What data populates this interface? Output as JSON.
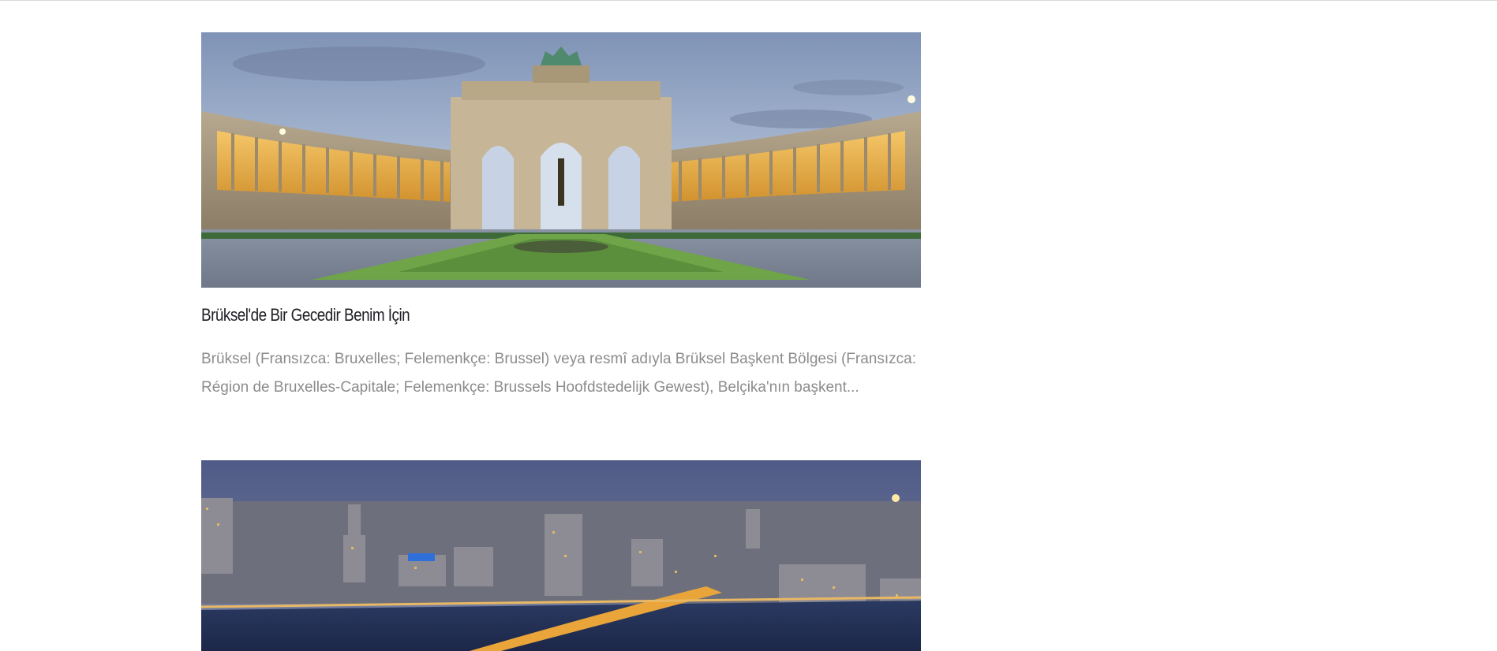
{
  "posts": [
    {
      "image_alt": "Cinquantenaire triumphal arch, Brussels, at dusk",
      "title": "Brüksel'de Bir Gecedir Benim İçin",
      "excerpt": "Brüksel (Fransızca: Bruxelles; Felemenkçe: Brussel) veya resmî adıyla Brüksel Başkent Bölgesi (Fransızca: Région de Bruxelles-Capitale; Felemenkçe: Brussels Hoofdstedelijk Gewest), Belçika'nın başkent..."
    },
    {
      "image_alt": "Night skyline of a city along a river"
    }
  ]
}
